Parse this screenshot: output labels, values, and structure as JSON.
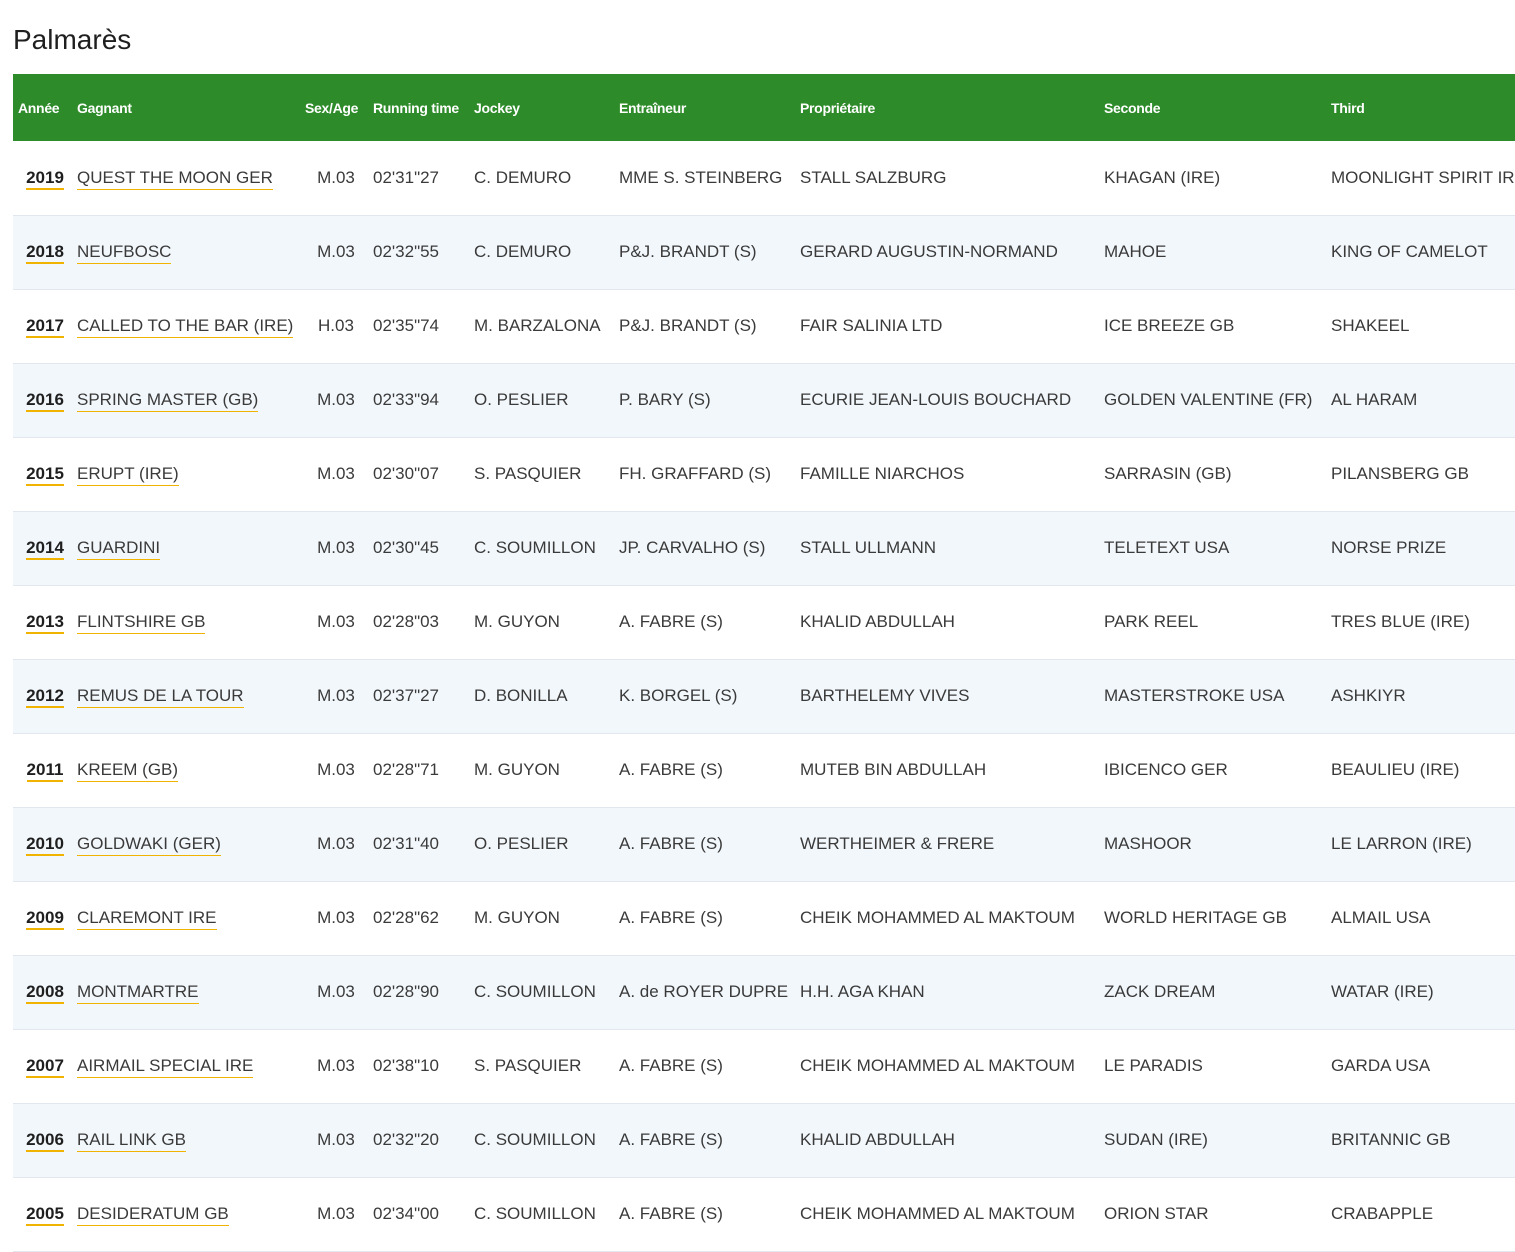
{
  "title": "Palmarès",
  "columns": {
    "year": "Année",
    "winner": "Gagnant",
    "sex_age": "Sex/Age",
    "running_time": "Running time",
    "jockey": "Jockey",
    "trainer": "Entraîneur",
    "owner": "Propriétaire",
    "second": "Seconde",
    "third": "Third"
  },
  "colors": {
    "header_bg": "#2e8b2a",
    "row_alt_bg": "#f2f7fb",
    "link_underline": "#f0b400"
  },
  "rows": [
    {
      "year": "2019",
      "winner": "QUEST THE MOON GER",
      "sex_age": "M.03",
      "time": "02'31\"27",
      "jockey": "C. DEMURO",
      "trainer": "MME S. STEINBERG",
      "owner": "STALL SALZBURG",
      "second": "KHAGAN (IRE)",
      "third": "MOONLIGHT SPIRIT IRE"
    },
    {
      "year": "2018",
      "winner": "NEUFBOSC",
      "sex_age": "M.03",
      "time": "02'32\"55",
      "jockey": "C. DEMURO",
      "trainer": "P&J. BRANDT (S)",
      "owner": "GERARD AUGUSTIN-NORMAND",
      "second": "MAHOE",
      "third": "KING OF CAMELOT"
    },
    {
      "year": "2017",
      "winner": "CALLED TO THE BAR (IRE)",
      "sex_age": "H.03",
      "time": "02'35\"74",
      "jockey": "M. BARZALONA",
      "trainer": "P&J. BRANDT (S)",
      "owner": "FAIR SALINIA LTD",
      "second": "ICE BREEZE GB",
      "third": "SHAKEEL"
    },
    {
      "year": "2016",
      "winner": "SPRING MASTER (GB)",
      "sex_age": "M.03",
      "time": "02'33\"94",
      "jockey": "O. PESLIER",
      "trainer": "P. BARY (S)",
      "owner": "ECURIE JEAN-LOUIS BOUCHARD",
      "second": "GOLDEN VALENTINE (FR)",
      "third": "AL HARAM"
    },
    {
      "year": "2015",
      "winner": "ERUPT (IRE)",
      "sex_age": "M.03",
      "time": "02'30\"07",
      "jockey": "S. PASQUIER",
      "trainer": "FH. GRAFFARD (S)",
      "owner": "FAMILLE NIARCHOS",
      "second": "SARRASIN (GB)",
      "third": "PILANSBERG GB"
    },
    {
      "year": "2014",
      "winner": "GUARDINI",
      "sex_age": "M.03",
      "time": "02'30\"45",
      "jockey": "C. SOUMILLON",
      "trainer": "JP. CARVALHO (S)",
      "owner": "STALL ULLMANN",
      "second": "TELETEXT USA",
      "third": "NORSE PRIZE"
    },
    {
      "year": "2013",
      "winner": "FLINTSHIRE GB",
      "sex_age": "M.03",
      "time": "02'28\"03",
      "jockey": "M. GUYON",
      "trainer": "A. FABRE (S)",
      "owner": "KHALID ABDULLAH",
      "second": "PARK REEL",
      "third": "TRES BLUE (IRE)"
    },
    {
      "year": "2012",
      "winner": "REMUS DE LA TOUR",
      "sex_age": "M.03",
      "time": "02'37\"27",
      "jockey": "D. BONILLA",
      "trainer": "K. BORGEL (S)",
      "owner": "BARTHELEMY VIVES",
      "second": "MASTERSTROKE USA",
      "third": "ASHKIYR"
    },
    {
      "year": "2011",
      "winner": "KREEM (GB)",
      "sex_age": "M.03",
      "time": "02'28\"71",
      "jockey": "M. GUYON",
      "trainer": "A. FABRE (S)",
      "owner": "MUTEB BIN ABDULLAH",
      "second": "IBICENCO GER",
      "third": "BEAULIEU (IRE)"
    },
    {
      "year": "2010",
      "winner": "GOLDWAKI (GER)",
      "sex_age": "M.03",
      "time": "02'31\"40",
      "jockey": "O. PESLIER",
      "trainer": "A. FABRE (S)",
      "owner": "WERTHEIMER & FRERE",
      "second": "MASHOOR",
      "third": "LE LARRON (IRE)"
    },
    {
      "year": "2009",
      "winner": "CLAREMONT IRE",
      "sex_age": "M.03",
      "time": "02'28\"62",
      "jockey": "M. GUYON",
      "trainer": "A. FABRE (S)",
      "owner": "CHEIK MOHAMMED AL MAKTOUM",
      "second": "WORLD HERITAGE GB",
      "third": "ALMAIL USA"
    },
    {
      "year": "2008",
      "winner": "MONTMARTRE",
      "sex_age": "M.03",
      "time": "02'28\"90",
      "jockey": "C. SOUMILLON",
      "trainer": "A. de ROYER DUPRE",
      "owner": "H.H. AGA KHAN",
      "second": "ZACK DREAM",
      "third": "WATAR (IRE)"
    },
    {
      "year": "2007",
      "winner": "AIRMAIL SPECIAL IRE",
      "sex_age": "M.03",
      "time": "02'38\"10",
      "jockey": "S. PASQUIER",
      "trainer": "A. FABRE (S)",
      "owner": "CHEIK MOHAMMED AL MAKTOUM",
      "second": "LE PARADIS",
      "third": "GARDA USA"
    },
    {
      "year": "2006",
      "winner": "RAIL LINK GB",
      "sex_age": "M.03",
      "time": "02'32\"20",
      "jockey": "C. SOUMILLON",
      "trainer": "A. FABRE (S)",
      "owner": "KHALID ABDULLAH",
      "second": "SUDAN (IRE)",
      "third": "BRITANNIC GB"
    },
    {
      "year": "2005",
      "winner": "DESIDERATUM GB",
      "sex_age": "M.03",
      "time": "02'34\"00",
      "jockey": "C. SOUMILLON",
      "trainer": "A. FABRE (S)",
      "owner": "CHEIK MOHAMMED AL MAKTOUM",
      "second": "ORION STAR",
      "third": "CRABAPPLE"
    }
  ]
}
